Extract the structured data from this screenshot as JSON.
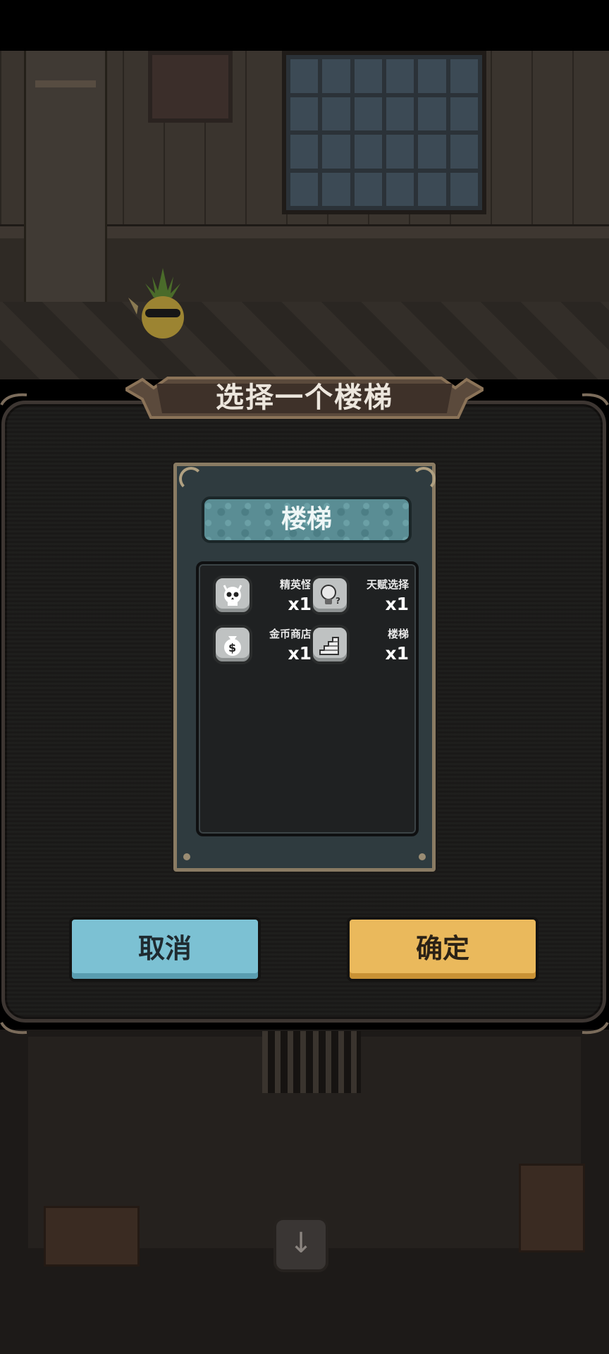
{
  "dialog": {
    "title": "选择一个楼梯",
    "card": {
      "title": "楼梯",
      "items": [
        {
          "icon": "skull-icon",
          "label": "精英怪",
          "count": "x1"
        },
        {
          "icon": "lightbulb-icon",
          "label": "天赋选择",
          "count": "x1"
        },
        {
          "icon": "money-bag-icon",
          "label": "金币商店",
          "count": "x1"
        },
        {
          "icon": "stairs-icon",
          "label": "楼梯",
          "count": "x1"
        }
      ]
    },
    "cancel_label": "取消",
    "confirm_label": "确定"
  },
  "colors": {
    "cancel_button": "#7cc1d3",
    "confirm_button": "#eab95c",
    "card_title": "#5a8d94",
    "dialog_bg": "#1b1a19"
  }
}
